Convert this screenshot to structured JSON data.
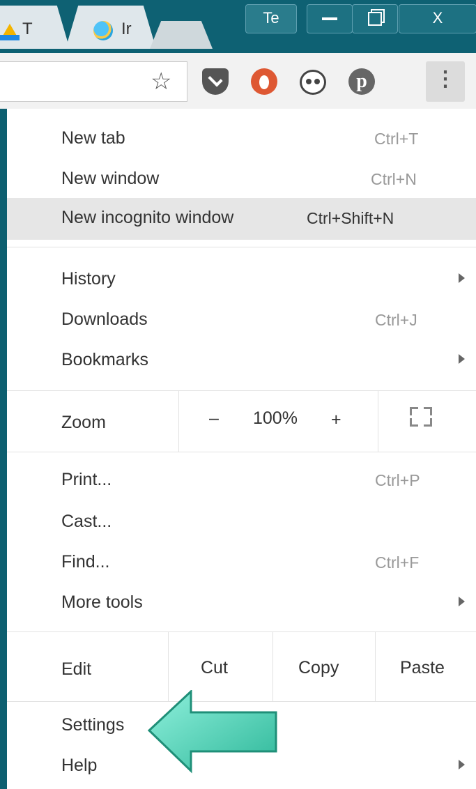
{
  "tabs": [
    {
      "label": "T",
      "icon": "google-drive-icon"
    },
    {
      "label": "Ir",
      "icon": "internet-explorer-icon"
    }
  ],
  "window_buttons": {
    "profile": "Te",
    "close": "X"
  },
  "extensions": [
    "pocket-icon",
    "duckduckgo-icon",
    "panda-icon",
    "pinterest-icon"
  ],
  "menu": {
    "new_tab": {
      "label": "New tab",
      "shortcut": "Ctrl+T"
    },
    "new_window": {
      "label": "New window",
      "shortcut": "Ctrl+N"
    },
    "new_incognito": {
      "label": "New incognito window",
      "shortcut": "Ctrl+Shift+N"
    },
    "history": {
      "label": "History"
    },
    "downloads": {
      "label": "Downloads",
      "shortcut": "Ctrl+J"
    },
    "bookmarks": {
      "label": "Bookmarks"
    },
    "zoom": {
      "label": "Zoom",
      "minus": "–",
      "value": "100%",
      "plus": "+"
    },
    "print": {
      "label": "Print...",
      "shortcut": "Ctrl+P"
    },
    "cast": {
      "label": "Cast..."
    },
    "find": {
      "label": "Find...",
      "shortcut": "Ctrl+F"
    },
    "more_tools": {
      "label": "More tools"
    },
    "edit": {
      "label": "Edit",
      "cut": "Cut",
      "copy": "Copy",
      "paste": "Paste"
    },
    "settings": {
      "label": "Settings"
    },
    "help": {
      "label": "Help"
    }
  },
  "colors": {
    "titlebar": "#0e6173",
    "highlight": "#e6e6e6",
    "callout_arrow": "#5fd6be"
  }
}
